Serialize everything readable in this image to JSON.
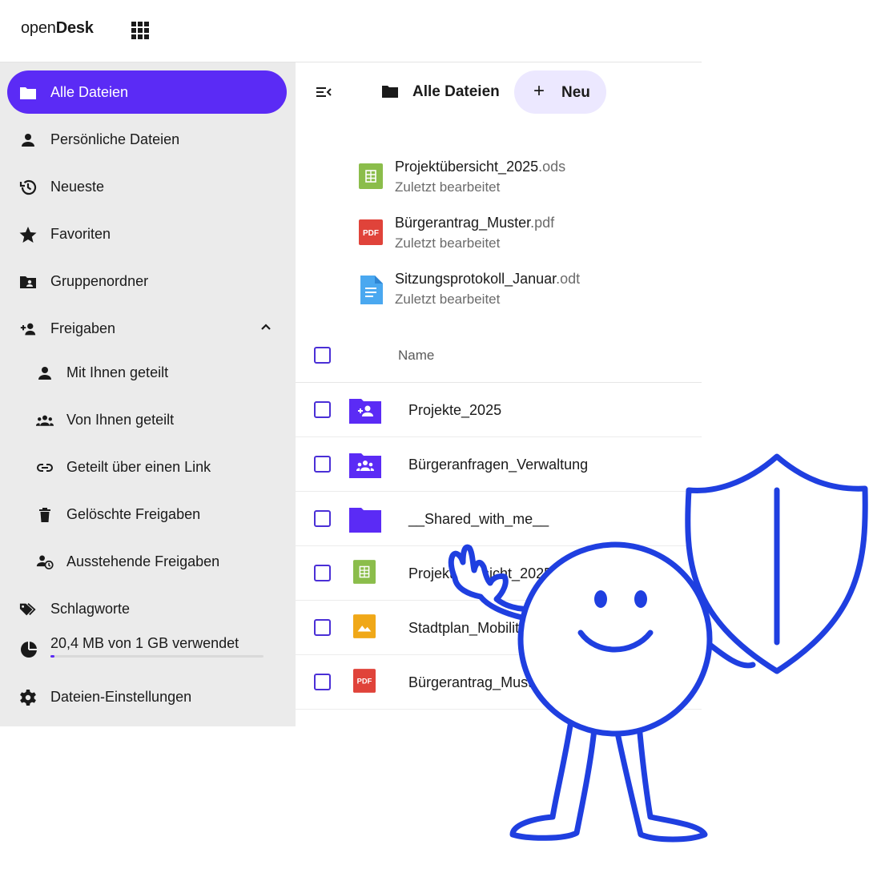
{
  "app": {
    "logo_prefix": "open",
    "logo_suffix": "Desk"
  },
  "sidebar": {
    "items": [
      {
        "label": "Alle Dateien",
        "icon": "folder-icon"
      },
      {
        "label": "Persönliche Dateien",
        "icon": "person-icon"
      },
      {
        "label": "Neueste",
        "icon": "history-icon"
      },
      {
        "label": "Favoriten",
        "icon": "star-icon"
      },
      {
        "label": "Gruppenordner",
        "icon": "group-folder-icon"
      },
      {
        "label": "Freigaben",
        "icon": "share-person-icon"
      },
      {
        "label": "Mit Ihnen geteilt",
        "icon": "person-icon"
      },
      {
        "label": "Von Ihnen geteilt",
        "icon": "people-icon"
      },
      {
        "label": "Geteilt über einen Link",
        "icon": "link-icon"
      },
      {
        "label": "Gelöschte Freigaben",
        "icon": "trash-icon"
      },
      {
        "label": "Ausstehende Freigaben",
        "icon": "pending-share-icon"
      },
      {
        "label": "Schlagworte",
        "icon": "tags-icon"
      }
    ],
    "quota": {
      "label": "20,4 MB von 1 GB verwendet",
      "used_fraction": 0.02
    },
    "settings_label": "Dateien-Einstellungen"
  },
  "breadcrumb": {
    "title": "Alle Dateien"
  },
  "new_button": {
    "label": "Neu"
  },
  "recent": [
    {
      "name": "Projektübersicht_2025",
      "ext": ".ods",
      "subtitle": "Zuletzt bearbeitet",
      "type": "spreadsheet"
    },
    {
      "name": "Bürgerantrag_Muster",
      "ext": ".pdf",
      "subtitle": "Zuletzt bearbeitet",
      "type": "pdf"
    },
    {
      "name": "Sitzungsprotokoll_Januar",
      "ext": ".odt",
      "subtitle": "Zuletzt bearbeitet",
      "type": "document"
    }
  ],
  "list": {
    "column_name": "Name",
    "rows": [
      {
        "name": "Projekte_2025",
        "type": "shared-folder"
      },
      {
        "name": "Bürgeranfragen_Verwaltung",
        "type": "group-folder"
      },
      {
        "name": "__Shared_with_me__",
        "type": "folder"
      },
      {
        "name": "Projektübersicht_2025",
        "type": "spreadsheet"
      },
      {
        "name": "Stadtplan_Mobilität",
        "type": "image"
      },
      {
        "name": "Bürgerantrag_Muster",
        "type": "pdf"
      }
    ]
  },
  "colors": {
    "accent": "#5b2bf5",
    "mascot": "#1f3fe0",
    "sidebar_bg": "#ebebeb"
  }
}
